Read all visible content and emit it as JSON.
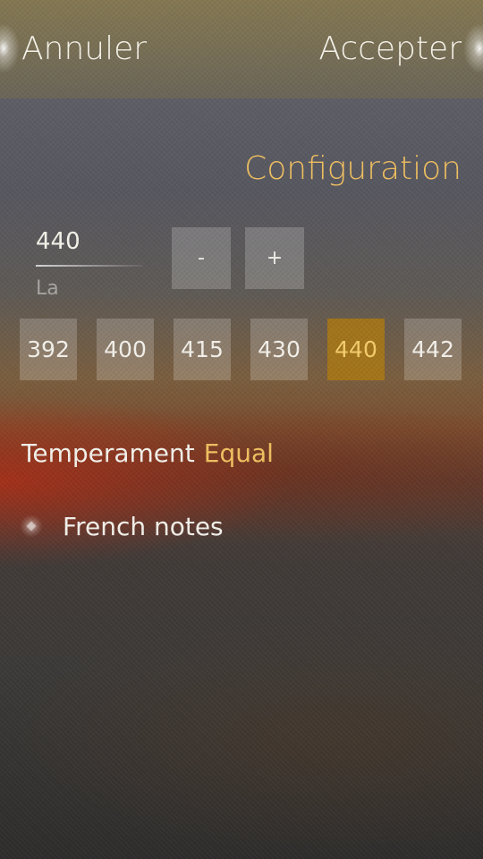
{
  "header": {
    "cancel_label": "Annuler",
    "accept_label": "Accepter"
  },
  "page": {
    "title": "Configuration"
  },
  "frequency": {
    "value": "440",
    "label": "La"
  },
  "stepper": {
    "minus_label": "-",
    "plus_label": "+"
  },
  "presets": [
    "392",
    "400",
    "415",
    "430",
    "440",
    "442"
  ],
  "presets_selected": "440",
  "temperament": {
    "label": "Temperament",
    "value": "Equal"
  },
  "french_notes": {
    "label": "French notes",
    "checked": false
  },
  "colors": {
    "accent": "#f0c060",
    "selected_bg": "#aa7814"
  }
}
